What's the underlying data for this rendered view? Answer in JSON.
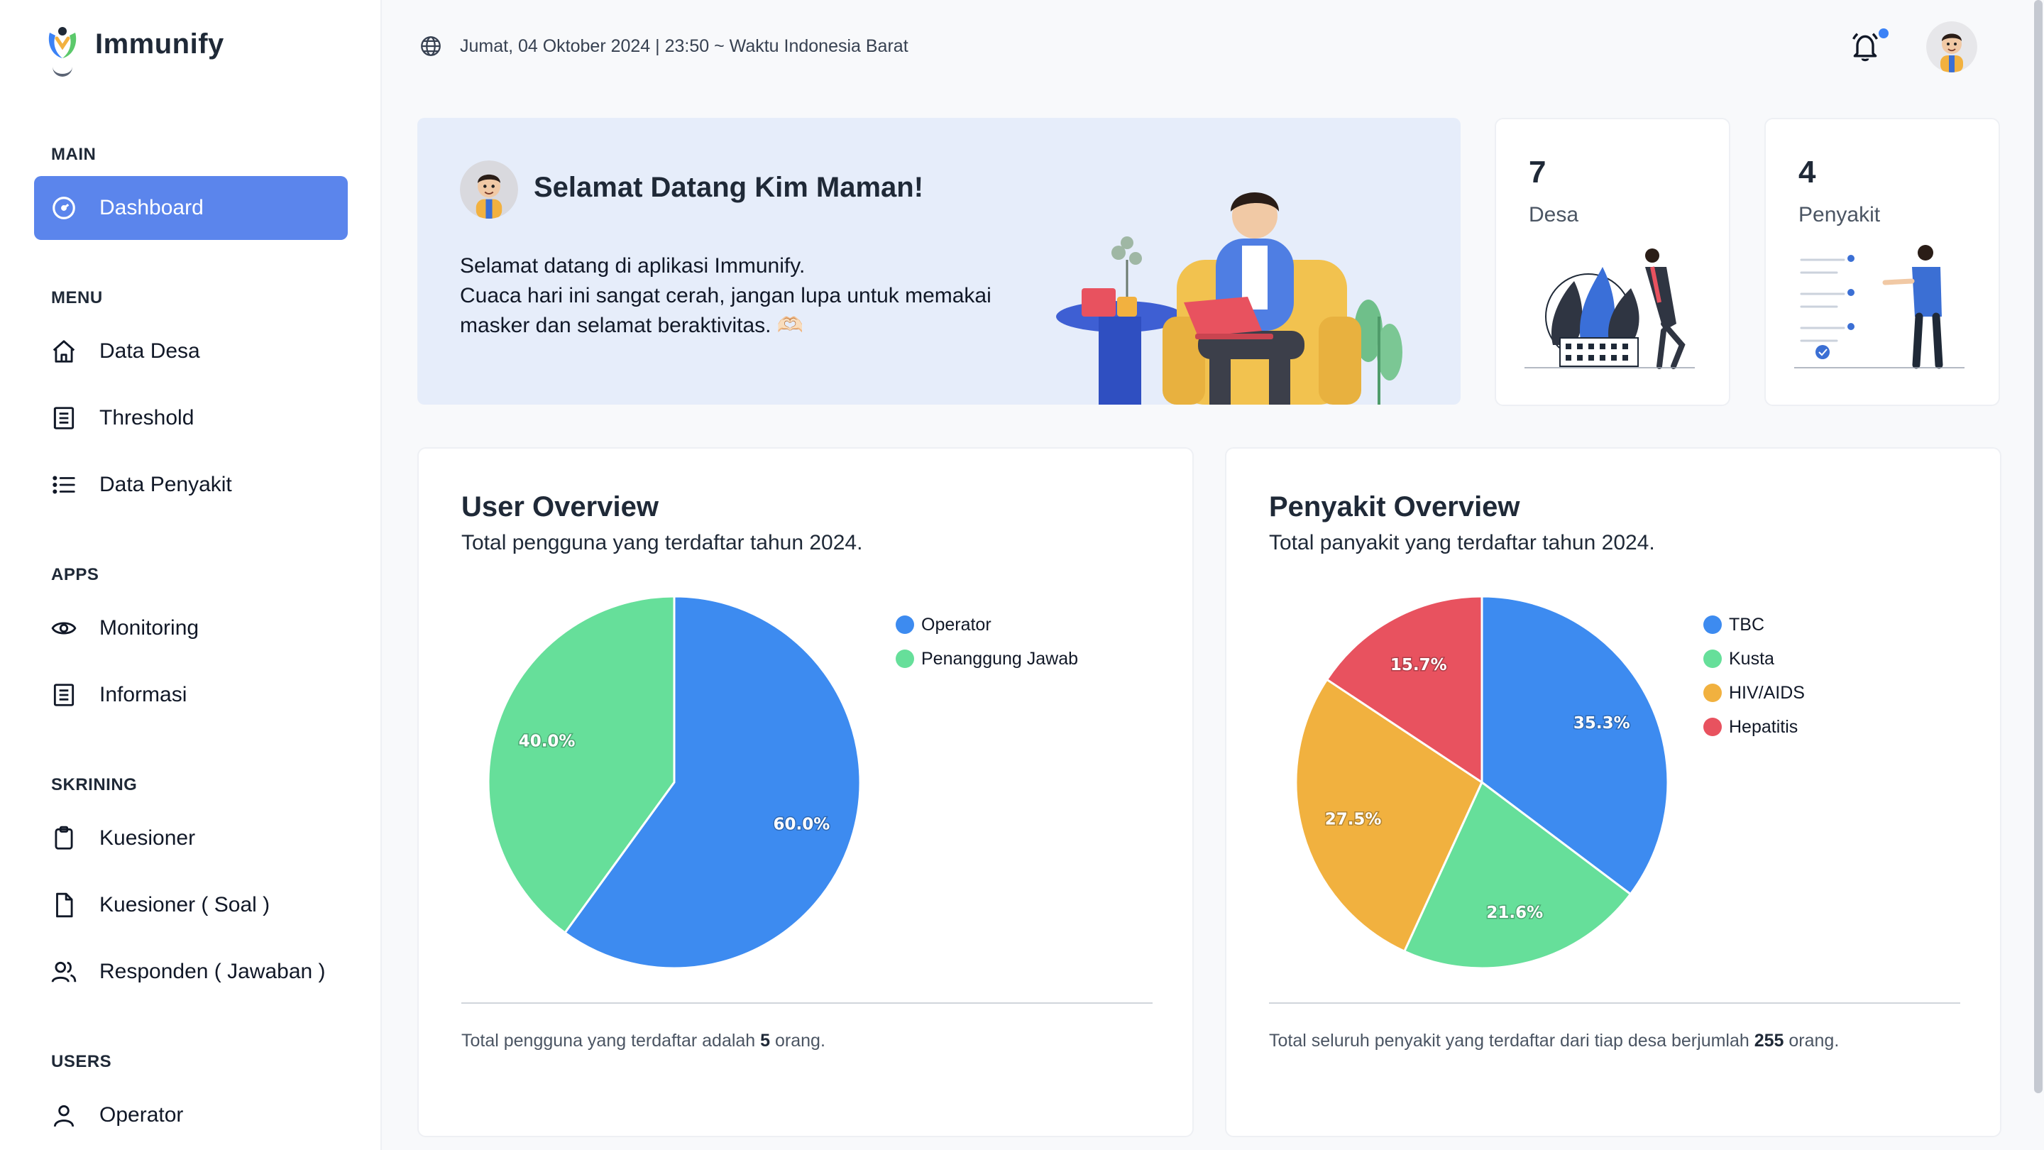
{
  "brand": {
    "name": "Immunify"
  },
  "header": {
    "datetime": "Jumat, 04 Oktober 2024 | 23:50 ~ Waktu Indonesia Barat",
    "globe_icon": "globe-icon",
    "bell_icon": "bell-icon",
    "has_notification": true
  },
  "sidebar": {
    "sections": [
      {
        "title": "MAIN",
        "items": [
          {
            "label": "Dashboard",
            "icon": "gauge-icon",
            "active": true
          }
        ]
      },
      {
        "title": "MENU",
        "items": [
          {
            "label": "Data Desa",
            "icon": "home-icon"
          },
          {
            "label": "Threshold",
            "icon": "list-box-icon"
          },
          {
            "label": "Data Penyakit",
            "icon": "list-icon"
          }
        ]
      },
      {
        "title": "APPS",
        "items": [
          {
            "label": "Monitoring",
            "icon": "eye-icon"
          },
          {
            "label": "Informasi",
            "icon": "list-box-icon"
          }
        ]
      },
      {
        "title": "SKRINING",
        "items": [
          {
            "label": "Kuesioner",
            "icon": "clipboard-icon"
          },
          {
            "label": "Kuesioner ( Soal )",
            "icon": "file-icon"
          },
          {
            "label": "Responden ( Jawaban )",
            "icon": "users-icon"
          }
        ]
      },
      {
        "title": "USERS",
        "items": [
          {
            "label": "Operator",
            "icon": "user-icon"
          }
        ]
      }
    ]
  },
  "welcome": {
    "title": "Selamat Datang Kim Maman!",
    "lines": [
      "Selamat datang di aplikasi Immunify.",
      "Cuaca hari ini sangat cerah, jangan lupa untuk memakai",
      "masker dan selamat beraktivitas. 🫶🏻"
    ]
  },
  "stats": [
    {
      "value": "7",
      "label": "Desa"
    },
    {
      "value": "4",
      "label": "Penyakit"
    }
  ],
  "user_overview": {
    "title": "User Overview",
    "subtitle": "Total pengguna yang terdaftar tahun 2024.",
    "footer_before": "Total pengguna yang terdaftar adalah ",
    "footer_bold": "5",
    "footer_after": " orang."
  },
  "penyakit_overview": {
    "title": "Penyakit Overview",
    "subtitle": "Total panyakit yang terdaftar tahun 2024.",
    "footer_before": "Total seluruh penyakit yang terdaftar dari tiap desa berjumlah ",
    "footer_bold": "255",
    "footer_after": " orang."
  },
  "chart_data": [
    {
      "type": "pie",
      "categories": [
        "Operator",
        "Penanggung Jawab"
      ],
      "values": [
        60.0,
        40.0
      ],
      "labels": [
        "60.0%",
        "40.0%"
      ],
      "colors": [
        "#3d8bf0",
        "#66df9a"
      ],
      "legend": "right"
    },
    {
      "type": "pie",
      "categories": [
        "TBC",
        "Kusta",
        "HIV/AIDS",
        "Hepatitis"
      ],
      "values": [
        35.3,
        21.6,
        27.5,
        15.7
      ],
      "labels": [
        "35.3%",
        "21.6%",
        "27.5%",
        "15.7%"
      ],
      "colors": [
        "#3d8bf0",
        "#66df9a",
        "#f1b13f",
        "#e8525f"
      ],
      "legend": "right"
    }
  ],
  "colors": {
    "accent": "#5b85ec",
    "welcome_bg": "#e6edfa"
  }
}
